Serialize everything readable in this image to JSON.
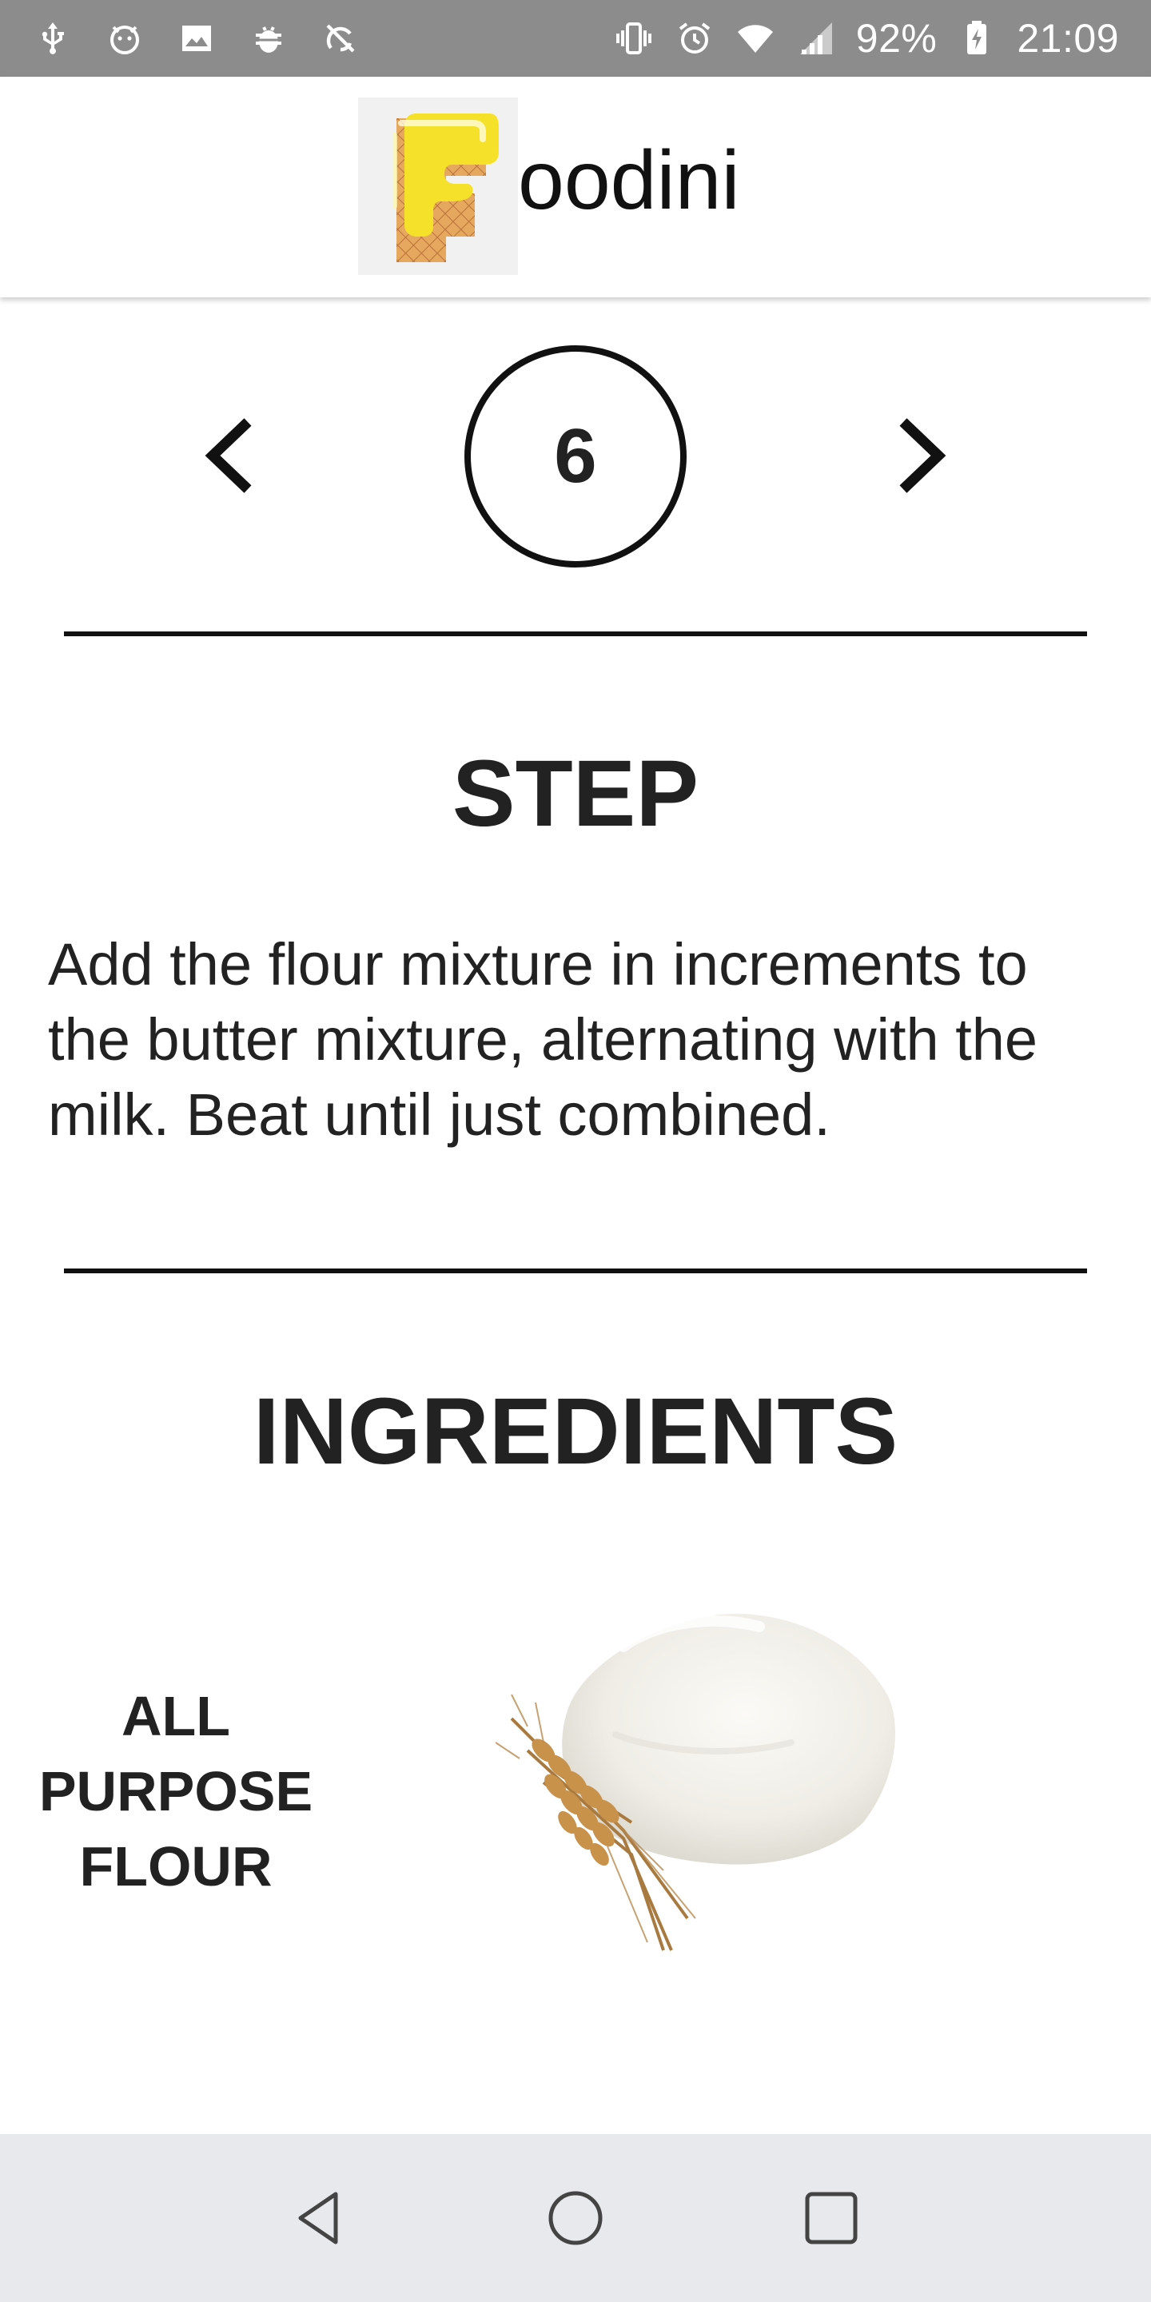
{
  "status_bar": {
    "left_icons": [
      "usb-icon",
      "android-face-icon",
      "image-icon",
      "bug-icon",
      "sync-off-icon"
    ],
    "right_icons": [
      "vibrate-icon",
      "alarm-icon",
      "wifi-icon",
      "signal-icon",
      "battery-charging-icon"
    ],
    "battery_percent": "92%",
    "time": "21:09"
  },
  "app_bar": {
    "title": "oodini",
    "logo": "foodini-logo-f-icon"
  },
  "step_nav": {
    "prev_icon": "chevron-left-icon",
    "next_icon": "chevron-right-icon",
    "current_step": "6"
  },
  "step": {
    "heading": "STEP",
    "text": "Add the flour mixture in increments to the butter mixture, alternating with the milk. Beat until just combined."
  },
  "ingredients": {
    "heading": "INGREDIENTS",
    "items": [
      {
        "name": "ALL PURPOSE FLOUR",
        "image": "flour-wheat-image"
      }
    ]
  },
  "nav_bar": {
    "buttons": [
      "back-icon",
      "home-icon",
      "recents-icon"
    ]
  },
  "colors": {
    "status_bar": "#8c8c8c",
    "nav_bar": "#e8e9ec",
    "text": "#222222",
    "logo_yellow": "#f5e12a",
    "logo_wafer": "#e2a45c"
  }
}
